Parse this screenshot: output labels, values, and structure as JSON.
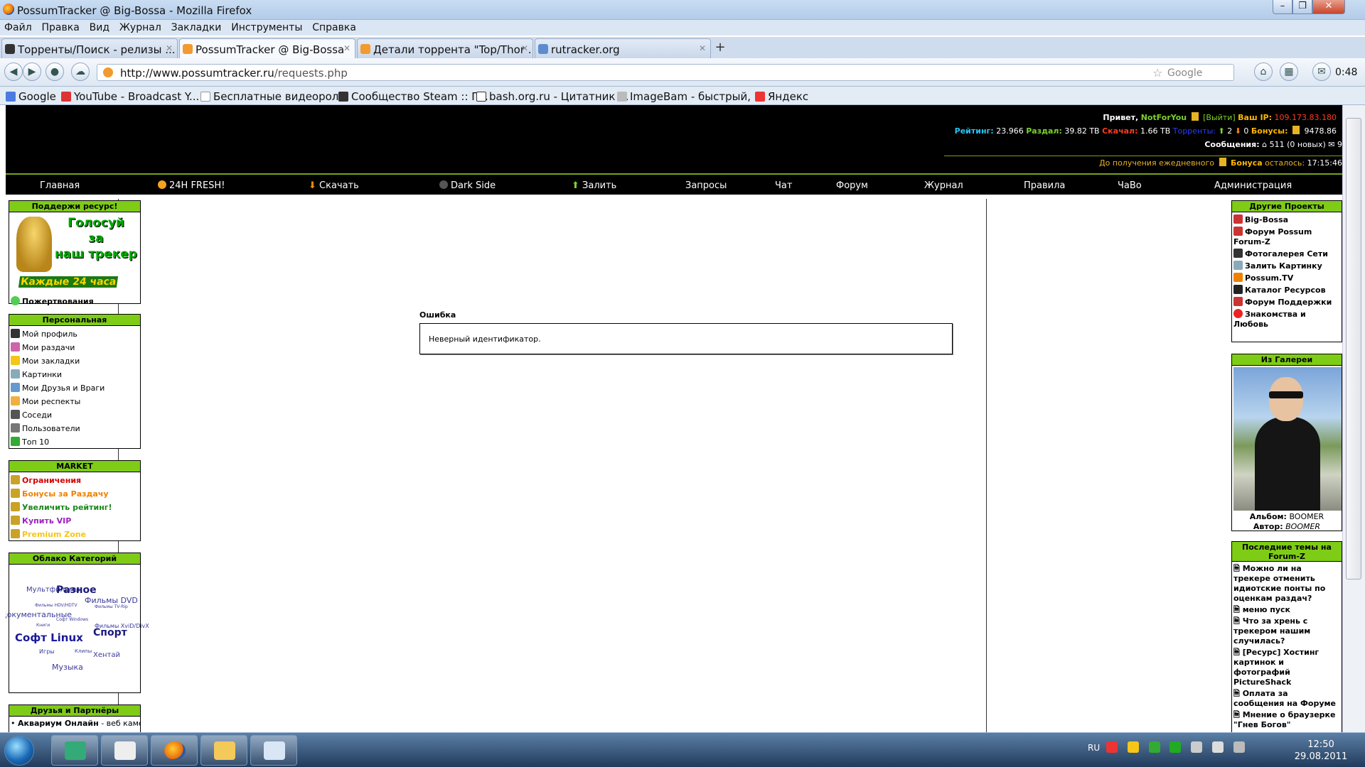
{
  "window": {
    "title": "PossumTracker @ Big-Bossa - Mozilla Firefox"
  },
  "menu": [
    "Файл",
    "Правка",
    "Вид",
    "Журнал",
    "Закладки",
    "Инструменты",
    "Справка"
  ],
  "tabs": [
    {
      "label": "Торренты/Поиск - релизы ..."
    },
    {
      "label": "PossumTracker @ Big-Bossa"
    },
    {
      "label": "Детали торрента \"Top/Thor ..."
    },
    {
      "label": "rutracker.org"
    }
  ],
  "nav": {
    "url_host": "http://www.possumtracker.ru",
    "url_path": "/requests.php",
    "search_engine": "Google",
    "time": "0:48"
  },
  "bookmarks": [
    "Google",
    "YouTube - Broadcast Y...",
    "Бесплатные видеорол...",
    "Сообщество Steam :: Г...",
    "bash.org.ru - Цитатник ...",
    "ImageBam - быстрый, ...",
    "Яндекс"
  ],
  "user": {
    "greet": "Привет,",
    "name": "NotForYou",
    "logout": "[Выйти]",
    "ip_label": "Ваш IP:",
    "ip": "109.173.83.180",
    "rating_label": "Рейтинг:",
    "rating": "23.966",
    "upload_label": "Раздал:",
    "upload": "39.82 TB",
    "download_label": "Скачал:",
    "download": "1.66 TB",
    "torrents_label": "Торренты:",
    "seeding": "2",
    "leeching": "0",
    "bonus_label": "Бонусы:",
    "bonus": "9478.86",
    "messages_label": "Сообщения:",
    "inbox": "511",
    "new_msgs": "(0 новых)",
    "outbox": "9",
    "daily_prefix": "До получения ежедневного",
    "daily_bonus": "Бонуса",
    "daily_left": "осталось:",
    "daily_time": "17:15:46"
  },
  "navmenu": [
    "Главная",
    "24H FRESH!",
    "Скачать",
    "Dark Side",
    "Залить",
    "Запросы",
    "Чат",
    "Форум",
    "Журнал",
    "Правила",
    "ЧаВо",
    "Администрация"
  ],
  "left": {
    "support": {
      "title": "Поддержи ресурс!",
      "vote_line1": "Голосуй",
      "vote_line2": "за",
      "vote_line3": "наш трекер",
      "vote_line4": "Каждые 24 часа",
      "donate": "Пожертвования"
    },
    "personal": {
      "title": "Персональная",
      "items": [
        "Мой профиль",
        "Мои раздачи",
        "Мои закладки",
        "Картинки",
        "Мои Друзья и Враги",
        "Мои респекты",
        "Соседи",
        "Пользователи",
        "Топ 10"
      ]
    },
    "market": {
      "title": "MARKET",
      "items": [
        "Ограничения",
        "Бонусы за Раздачу",
        "Увеличить рейтинг!",
        "Купить VIP",
        "Premium Zone"
      ]
    },
    "cloud": {
      "title": "Облако Категорий",
      "tags": [
        "Мультфильмы",
        "Разное",
        "Фильмы DVD",
        "Фильмы HDV/HDTV",
        "Фильмы TV-Rip",
        "Документальные",
        "Книги",
        "Софт Windows",
        "Фильмы XviD/DivX",
        "Софт Linux",
        "Спорт",
        "Игры",
        "Клипы",
        "Хентай",
        "Музыка"
      ]
    },
    "friends": {
      "title": "Друзья и Партнёры",
      "item_name": "Аквариум Онлайн",
      "item_desc": "- веб камеры"
    }
  },
  "main": {
    "error_title": "Ошибка",
    "error_text": "Неверный идентификатор."
  },
  "right": {
    "projects": {
      "title": "Другие Проекты",
      "items": [
        "Big-Bossa",
        "Форум Possum Forum-Z",
        "Фотогалерея Сети",
        "Залить Картинку",
        "Possum.TV",
        "Каталог Ресурсов",
        "Форум Поддержки",
        "Знакомства и Любовь"
      ]
    },
    "gallery": {
      "title": "Из Галереи",
      "album_label": "Альбом:",
      "album": "BOOMER",
      "author_label": "Автор:",
      "author": "BOOMER"
    },
    "topics": {
      "title": "Последние темы на Forum-Z",
      "items": [
        "Можно ли на трекере отменить идиотские понты по оценкам раздач?",
        "меню пуск",
        "Что за хрень с трекером нашим случилась?",
        "[Ресурс] Хостинг картинок и фотографий PictureShack",
        "Оплата за сообщения на Форуме",
        "Мнение о браузерке \"Гнев Богов\""
      ]
    }
  },
  "taskbar": {
    "lang": "RU",
    "time": "12:50",
    "date": "29.08.2011"
  }
}
